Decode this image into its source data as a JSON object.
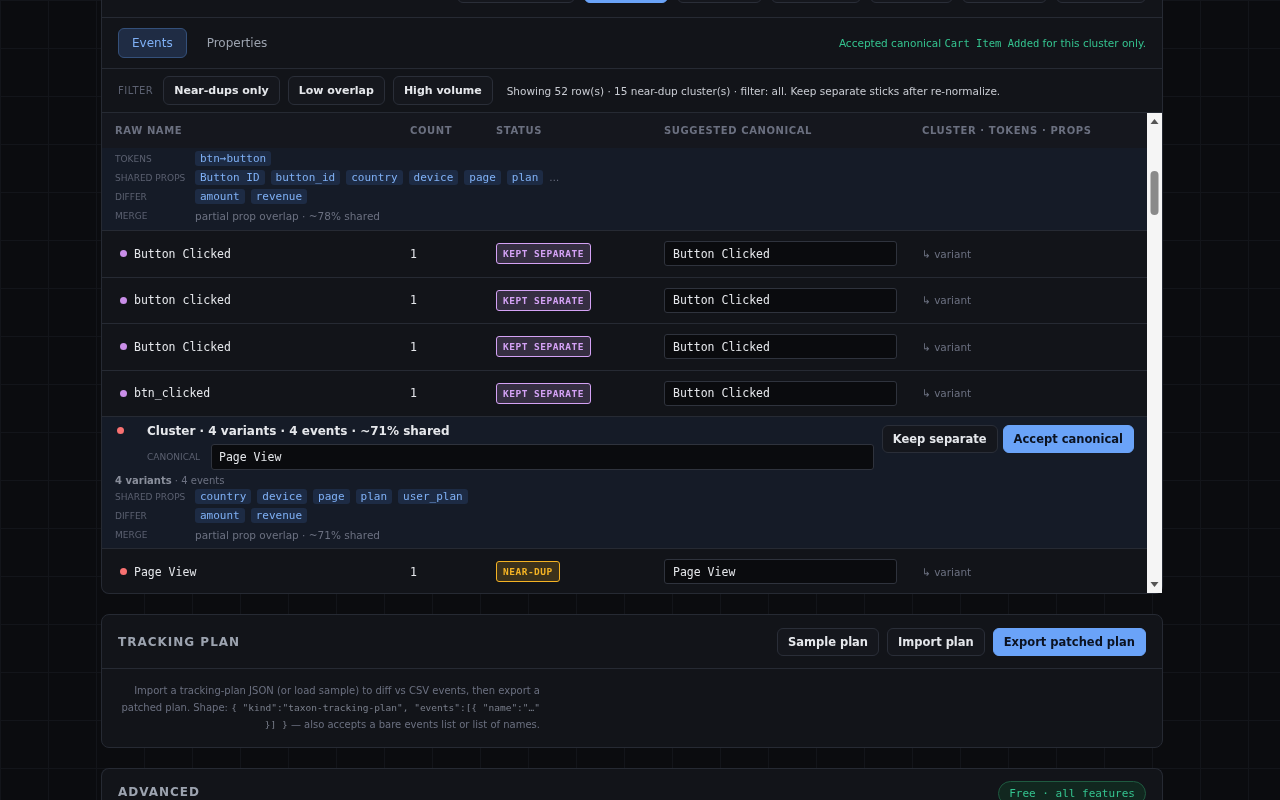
{
  "toolbar": [
    {
      "selected": false
    },
    {
      "selected": true
    },
    {
      "selected": false
    },
    {
      "selected": false
    },
    {
      "selected": false
    },
    {
      "selected": false
    },
    {
      "selected": false
    }
  ],
  "tabs": [
    {
      "label": "Events",
      "selected": true
    },
    {
      "label": "Properties",
      "selected": false
    }
  ],
  "notice": {
    "before": "Accepted canonical ",
    "code": "Cart Item Added",
    "after": " for this cluster only."
  },
  "filter": {
    "label": "FILTER",
    "chips": [
      {
        "label": "Near-dups only",
        "selected": false
      },
      {
        "label": "Low overlap",
        "selected": false
      },
      {
        "label": "High volume",
        "selected": false
      }
    ],
    "summary": "Showing 52 row(s) · 15 near-dup cluster(s) · filter: all. Keep separate sticks after re-normalize."
  },
  "table": {
    "columns": [
      "RAW NAME",
      "COUNT",
      "STATUS",
      "SUGGESTED CANONICAL",
      "CLUSTER · TOKENS · PROPS"
    ],
    "items": [
      {
        "kind": "details",
        "rows": [
          {
            "label": "TOKENS",
            "tags": [
              "btn→button"
            ]
          },
          {
            "label": "SHARED PROPS",
            "tags": [
              "Button ID",
              "button_id",
              "country",
              "device",
              "page",
              "plan"
            ],
            "more": "…"
          },
          {
            "label": "DIFFER",
            "tags": [
              "amount",
              "revenue"
            ]
          },
          {
            "label": "MERGE",
            "text": "partial prop overlap · ~78% shared"
          }
        ]
      },
      {
        "kind": "row",
        "name": "Button Clicked",
        "color": "#c98ee8",
        "count": "1",
        "status": {
          "label": "KEPT SEPARATE",
          "color": "#d4a2f5"
        },
        "canonical": "Button Clicked",
        "cluster": "↳ variant"
      },
      {
        "kind": "row",
        "name": "button clicked",
        "color": "#c98ee8",
        "count": "1",
        "status": {
          "label": "KEPT SEPARATE",
          "color": "#d4a2f5"
        },
        "canonical": "Button Clicked",
        "cluster": "↳ variant"
      },
      {
        "kind": "row",
        "name": "Button Clicked",
        "color": "#c98ee8",
        "count": "1",
        "status": {
          "label": "KEPT SEPARATE",
          "color": "#d4a2f5"
        },
        "canonical": "Button Clicked",
        "cluster": "↳ variant"
      },
      {
        "kind": "row",
        "name": "btn_clicked",
        "color": "#c98ee8",
        "count": "1",
        "status": {
          "label": "KEPT SEPARATE",
          "color": "#d4a2f5"
        },
        "canonical": "Button Clicked",
        "cluster": "↳ variant"
      },
      {
        "kind": "cluster",
        "color": "#f87171",
        "title": "Cluster · 4 variants · 4 events · ~71% shared",
        "canonical_label": "CANONICAL",
        "canonical": "Page View",
        "buttons": [
          {
            "label": "Keep separate",
            "primary": false
          },
          {
            "label": "Accept canonical",
            "primary": true
          }
        ],
        "summary": "**4 variants** · 4 events",
        "rows": [
          {
            "label": "SHARED PROPS",
            "tags": [
              "country",
              "device",
              "page",
              "plan",
              "user_plan"
            ]
          },
          {
            "label": "DIFFER",
            "tags": [
              "amount",
              "revenue"
            ]
          },
          {
            "label": "MERGE",
            "text": "partial prop overlap · ~71% shared"
          }
        ]
      },
      {
        "kind": "row",
        "name": "Page View",
        "color": "#f87171",
        "count": "1",
        "status": {
          "label": "NEAR-DUP",
          "color": "#f5b324"
        },
        "canonical": "Page View",
        "cluster": "↳ variant"
      }
    ]
  },
  "tracking_plan": {
    "title": "TRACKING PLAN",
    "buttons": [
      {
        "label": "Sample plan",
        "primary": false
      },
      {
        "label": "Import plan",
        "primary": false
      },
      {
        "label": "Export patched plan",
        "primary": true
      }
    ],
    "description": [
      {
        "kind": "text",
        "text": "Import a tracking-plan JSON (or load sample) to diff vs CSV events, then export a patched plan. Shape: "
      },
      {
        "kind": "code",
        "text": "{ \"kind\":\"taxon-tracking-plan\", \"events\":[{ \"name\":\"…\" }] }"
      },
      {
        "kind": "text",
        "text": " — also accepts a bare events list or list of names."
      }
    ]
  },
  "advanced": {
    "title": "ADVANCED",
    "badge": "Free · all features"
  }
}
